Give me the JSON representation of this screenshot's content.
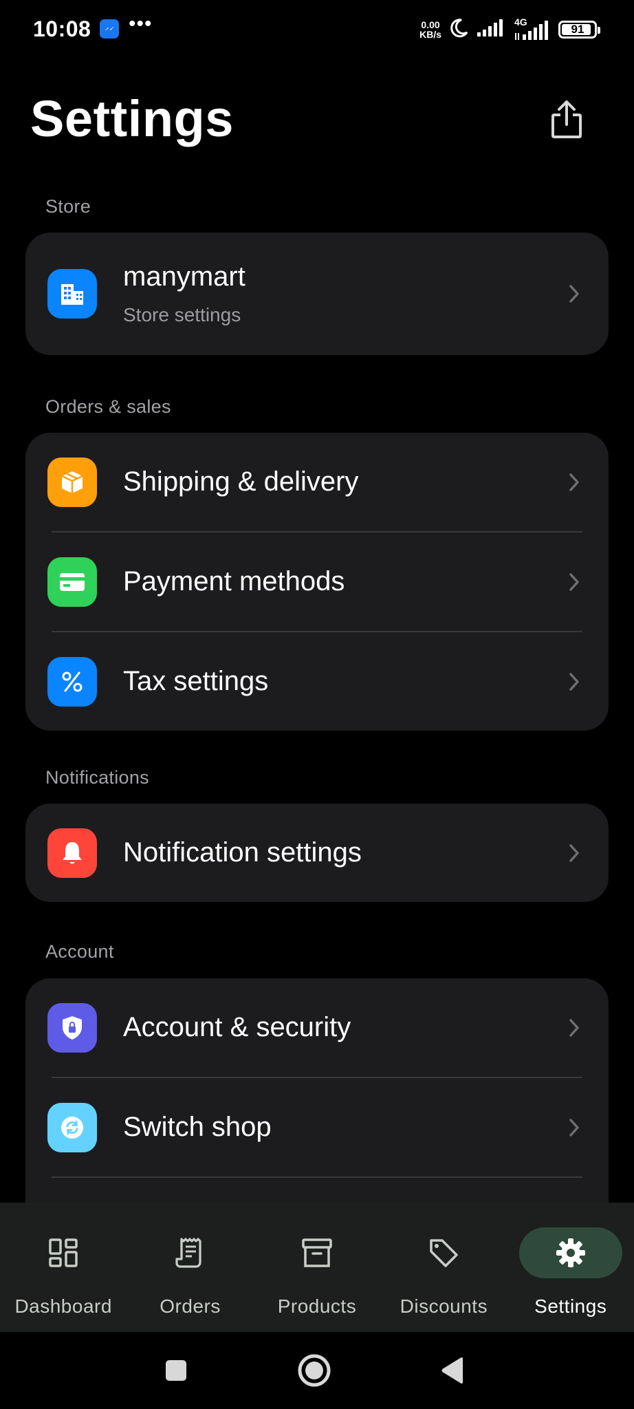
{
  "status_bar": {
    "time": "10:08",
    "dots": "•••",
    "net_speed_value": "0.00",
    "net_speed_unit": "KB/s",
    "network_type": "4G",
    "battery": "91",
    "battery_level_percent": 91
  },
  "header": {
    "title": "Settings"
  },
  "sections": {
    "store": {
      "label": "Store",
      "items": [
        {
          "title": "manymart",
          "subtitle": "Store settings",
          "icon": "building-icon",
          "color": "#0a84ff"
        }
      ]
    },
    "orders_sales": {
      "label": "Orders & sales",
      "items": [
        {
          "label": "Shipping & delivery",
          "icon": "box-icon",
          "color": "#ff9f0a"
        },
        {
          "label": "Payment methods",
          "icon": "card-icon",
          "color": "#30d158"
        },
        {
          "label": "Tax settings",
          "icon": "percent-icon",
          "color": "#0a84ff"
        }
      ]
    },
    "notifications": {
      "label": "Notifications",
      "items": [
        {
          "label": "Notification settings",
          "icon": "bell-icon",
          "color": "#ff453a"
        }
      ]
    },
    "account": {
      "label": "Account",
      "items": [
        {
          "label": "Account & security",
          "icon": "shield-icon",
          "color": "#5e5ce6"
        },
        {
          "label": "Switch shop",
          "icon": "refresh-icon",
          "color": "#64d2ff"
        },
        {
          "label": "",
          "icon": "partial-icon",
          "color": "#30d158"
        }
      ]
    }
  },
  "bottom_nav": {
    "items": [
      {
        "label": "Dashboard",
        "icon": "dashboard-icon"
      },
      {
        "label": "Orders",
        "icon": "receipt-icon"
      },
      {
        "label": "Products",
        "icon": "archive-icon"
      },
      {
        "label": "Discounts",
        "icon": "tag-icon"
      },
      {
        "label": "Settings",
        "icon": "gear-icon",
        "active": true
      }
    ]
  },
  "colors": {
    "background": "#000000",
    "card": "#1c1c1e",
    "section_label": "#a2a2a7",
    "nav_background": "#1c1f1d",
    "nav_active_pill": "#2f4a3c"
  }
}
